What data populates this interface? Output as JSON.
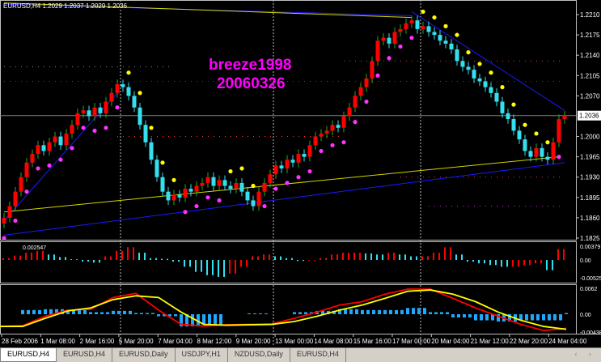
{
  "window": {
    "symbol_info": "EURUSD,H4  1.2029 1.2037 1.2029 1.2036"
  },
  "watermark": {
    "line1": "breeze1998",
    "line2": "20060326"
  },
  "tabs": [
    {
      "label": "EURUSD,H4",
      "active": true
    },
    {
      "label": "EURUSD,H4"
    },
    {
      "label": "EURUSD,Daily"
    },
    {
      "label": "USDJPY,H1"
    },
    {
      "label": "NZDUSD,Daily"
    },
    {
      "label": "EURUSD,H4"
    }
  ],
  "scroll_arrows": "‹ ›",
  "colors": {
    "bull": "#ff0000",
    "bear": "#33e0f0",
    "sar_up": "#ffff00",
    "sar_down": "#ff33ff",
    "channel": "#1a1aff",
    "trend": "#d4d400",
    "macd": "#ff0000",
    "signal": "#ffff00",
    "osma": "#1ea8ff"
  },
  "chart_data": [
    {
      "type": "candlestick",
      "title": "EURUSD,H4",
      "ylim": [
        1.1825,
        1.221
      ],
      "y_ticks": [
        "1.2210",
        "1.2175",
        "1.2140",
        "1.2105",
        "1.2070",
        "1.2036",
        "1.2000",
        "1.1965",
        "1.1930",
        "1.1895",
        "1.1860",
        "1.1825"
      ],
      "current_price": "1.2036",
      "x_ticks": [
        "28 Feb 2006",
        "1 Mar 08:00",
        "2 Mar 16:00",
        "5 Mar 20:00",
        "7 Mar 04:00",
        "8 Mar 12:00",
        "9 Mar 20:00",
        "13 Mar 00:00",
        "14 Mar 08:00",
        "15 Mar 16:00",
        "17 Mar 00:00",
        "20 Mar 04:00",
        "21 Mar 12:00",
        "22 Mar 20:00",
        "24 Mar 04:00"
      ],
      "closes": [
        1.186,
        1.188,
        1.1905,
        1.193,
        1.1955,
        1.197,
        1.1985,
        1.1975,
        1.199,
        1.2,
        1.1985,
        1.2005,
        1.202,
        1.204,
        1.2045,
        1.2035,
        1.205,
        1.204,
        1.206,
        1.2075,
        1.209,
        1.2085,
        1.207,
        1.205,
        1.202,
        1.199,
        1.196,
        1.193,
        1.1905,
        1.189,
        1.19,
        1.1895,
        1.191,
        1.1905,
        1.1915,
        1.192,
        1.193,
        1.1915,
        1.1925,
        1.1915,
        1.191,
        1.192,
        1.1905,
        1.189,
        1.188,
        1.1905,
        1.192,
        1.1935,
        1.195,
        1.1945,
        1.196,
        1.1955,
        1.197,
        1.1965,
        1.1985,
        1.2,
        1.2005,
        1.201,
        1.202,
        1.2015,
        1.2035,
        1.205,
        1.207,
        1.2085,
        1.21,
        1.213,
        1.2165,
        1.217,
        1.216,
        1.218,
        1.2185,
        1.2195,
        1.22,
        1.2185,
        1.219,
        1.218,
        1.2175,
        1.2165,
        1.216,
        1.215,
        1.213,
        1.212,
        1.2115,
        1.21,
        1.2095,
        1.2085,
        1.2075,
        1.206,
        1.204,
        1.203,
        1.201,
        1.1995,
        1.1975,
        1.1965,
        1.198,
        1.1965,
        1.196,
        1.199,
        1.203,
        1.2036
      ],
      "trendlines": [
        {
          "color": "channel",
          "from": [
            0,
            1.183
          ],
          "to": [
            99,
            1.1955
          ]
        },
        {
          "color": "channel",
          "from": [
            0,
            1.1855
          ],
          "to": [
            20,
            1.2075
          ]
        },
        {
          "color": "channel",
          "from": [
            72,
            1.2215
          ],
          "to": [
            99,
            1.2045
          ]
        },
        {
          "color": "channel",
          "from": [
            0,
            1.2228
          ],
          "to": [
            72,
            1.2208
          ]
        },
        {
          "color": "trend",
          "from": [
            0,
            1.187
          ],
          "to": [
            98,
            1.1965
          ]
        },
        {
          "color": "trend",
          "from": [
            0,
            1.223
          ],
          "to": [
            72,
            1.2205
          ]
        }
      ],
      "levels": [
        {
          "price": 1.213,
          "color": "#ff3030",
          "from": 60,
          "to": 99
        },
        {
          "price": 1.212,
          "color": "#888888",
          "from": 0,
          "to": 30
        },
        {
          "price": 1.2095,
          "color": "#3030ff",
          "from": 0,
          "to": 99
        },
        {
          "price": 1.2,
          "color": "#ff3030",
          "from": 20,
          "to": 60
        },
        {
          "price": 1.193,
          "color": "#ff3030",
          "from": 70,
          "to": 99
        },
        {
          "price": 1.188,
          "color": "#c030c0",
          "from": 75,
          "to": 99
        }
      ],
      "period_separators": [
        20,
        47,
        73
      ]
    },
    {
      "type": "bar",
      "top_label": "0.002547",
      "ylim": [
        -0.00525,
        0.00379
      ],
      "y_ticks": [
        "0.00379",
        "0.00",
        "-0.00525"
      ],
      "values": [
        0.0005,
        0.0012,
        0.002,
        0.0025,
        0.0015,
        0.0008,
        0.0002,
        -0.0005,
        -0.0008,
        0.001,
        0.0025,
        0.0035,
        0.002,
        0.0005,
        0.0003,
        -0.0005,
        -0.002,
        -0.0035,
        -0.0045,
        -0.005,
        -0.004,
        -0.002,
        0.001,
        0.0015,
        0.001,
        0.0005,
        -0.0003,
        -0.0002,
        0.0005,
        0.0015,
        0.002,
        0.002,
        0.0018,
        0.0015,
        0.002,
        0.0015,
        0.001,
        0.001,
        0.002,
        0.0035,
        0.0015,
        -0.0005,
        -0.001,
        -0.0015,
        -0.002,
        -0.002,
        -0.0015,
        -0.001,
        -0.003,
        0.003
      ]
    },
    {
      "type": "line",
      "ylim": [
        -0.00438,
        0.0062
      ],
      "y_ticks": [
        "0.0062",
        "0.00",
        "-0.00438"
      ],
      "series": [
        {
          "color": "macd",
          "values": [
            -0.003,
            -0.0028,
            -0.0005,
            0.001,
            0.0012,
            0.004,
            0.005,
            0.001,
            -0.0025,
            -0.0029,
            -0.0026,
            -0.0025,
            -0.0024,
            -0.001,
            0.0005,
            0.0022,
            0.003,
            0.0048,
            0.006,
            0.006,
            0.0038,
            0.0015,
            -0.0005,
            -0.0025,
            -0.004,
            -0.0035
          ]
        },
        {
          "color": "signal",
          "values": [
            -0.003,
            -0.003,
            -0.001,
            0.0008,
            0.0015,
            0.0035,
            0.0044,
            0.004,
            0.0005,
            -0.0025,
            -0.0027,
            -0.0026,
            -0.0025,
            -0.0018,
            -0.0005,
            0.001,
            0.0022,
            0.0038,
            0.0055,
            0.0058,
            0.0048,
            0.003,
            0.0005,
            -0.0015,
            -0.003,
            -0.0037
          ]
        }
      ],
      "histogram": [
        0,
        0.001,
        0.0012,
        0.001,
        0.0005,
        0.0008,
        0.0003,
        -0.0005,
        -0.003,
        -0.0025,
        0,
        0.0002,
        0,
        0.0005,
        0.0008,
        0.0012,
        0.001,
        0.001,
        0.0015,
        0.0005,
        -0.0008,
        -0.0015,
        -0.0018,
        -0.0015,
        -0.0015,
        0.0003
      ]
    }
  ]
}
